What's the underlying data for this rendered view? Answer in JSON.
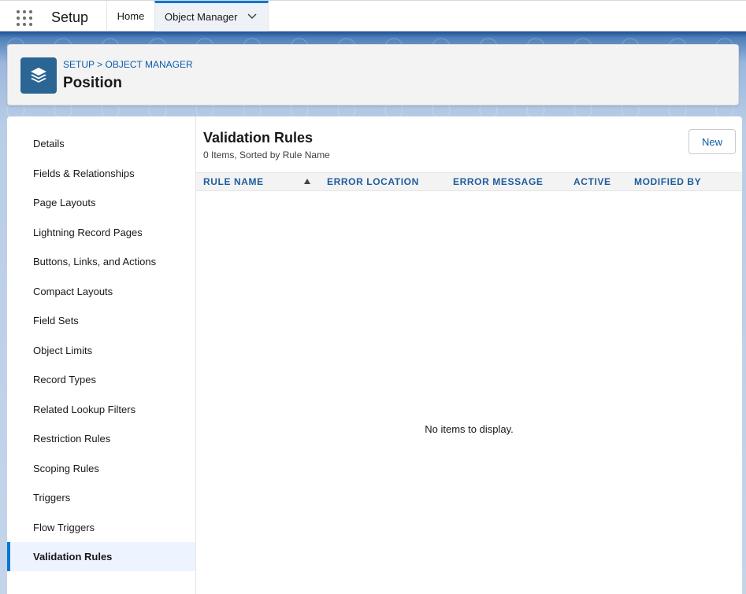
{
  "topnav": {
    "app_name": "Setup",
    "tabs": [
      {
        "label": "Home"
      },
      {
        "label": "Object Manager"
      }
    ]
  },
  "header": {
    "breadcrumb": [
      "SETUP",
      "OBJECT MANAGER"
    ],
    "breadcrumb_separator": ">",
    "title": "Position",
    "icon": "layers-icon",
    "icon_color": "#2a6594"
  },
  "sidebar": {
    "items": [
      {
        "label": "Details"
      },
      {
        "label": "Fields & Relationships"
      },
      {
        "label": "Page Layouts"
      },
      {
        "label": "Lightning Record Pages"
      },
      {
        "label": "Buttons, Links, and Actions"
      },
      {
        "label": "Compact Layouts"
      },
      {
        "label": "Field Sets"
      },
      {
        "label": "Object Limits"
      },
      {
        "label": "Record Types"
      },
      {
        "label": "Related Lookup Filters"
      },
      {
        "label": "Restriction Rules"
      },
      {
        "label": "Scoping Rules"
      },
      {
        "label": "Triggers"
      },
      {
        "label": "Flow Triggers"
      },
      {
        "label": "Validation Rules"
      }
    ],
    "active": "Validation Rules"
  },
  "list": {
    "title": "Validation Rules",
    "subtitle": "0 Items, Sorted by Rule Name",
    "new_label": "New",
    "columns": [
      "RULE NAME",
      "ERROR LOCATION",
      "ERROR MESSAGE",
      "ACTIVE",
      "MODIFIED BY"
    ],
    "sort_column": "RULE NAME",
    "sort_direction": "ascending",
    "rows": [],
    "empty_message": "No items to display."
  },
  "colors": {
    "accent": "#0176d3",
    "link": "#0b5cab",
    "header_band": "#1b5297"
  }
}
